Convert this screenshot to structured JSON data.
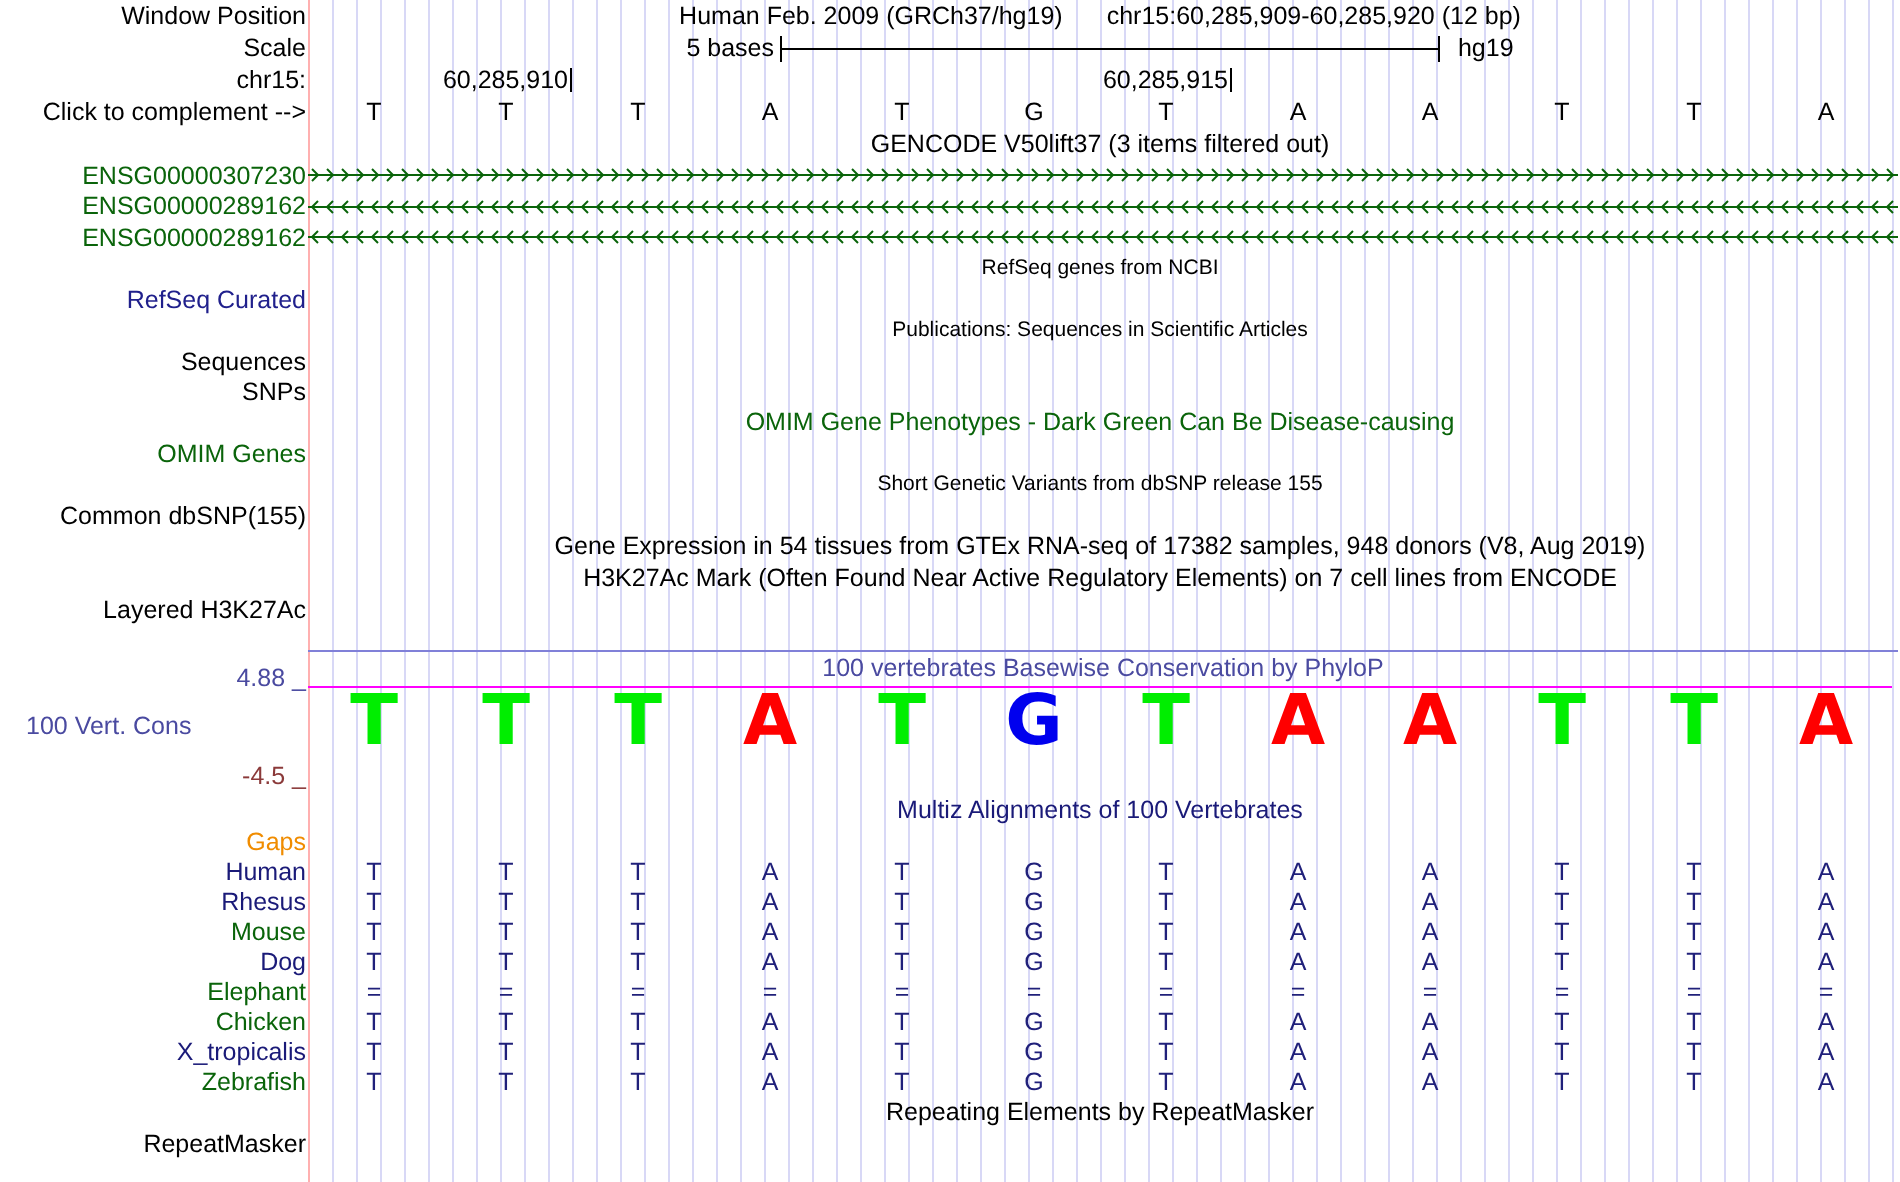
{
  "header": {
    "label": "Window Position",
    "assembly": "Human Feb. 2009 (GRCh37/hg19)",
    "position": "chr15:60,285,909-60,285,920 (12 bp)"
  },
  "scale": {
    "label": "Scale",
    "bar_label": "5 bases",
    "assembly": "hg19"
  },
  "coordinates": {
    "label": "chr15:",
    "ticks": [
      "60,285,910",
      "60,285,915"
    ]
  },
  "bases": {
    "label": "Click to complement -->",
    "sequence": [
      "T",
      "T",
      "T",
      "A",
      "T",
      "G",
      "T",
      "A",
      "A",
      "T",
      "T",
      "A"
    ]
  },
  "rows": [
    {
      "kind": "title",
      "text": "GENCODE V50lift37 (3 items filtered out)",
      "color": "#000000"
    },
    {
      "kind": "gene",
      "label": "ENSG00000307230",
      "color": "#0a640a",
      "reverse": false
    },
    {
      "kind": "gene",
      "label": "ENSG00000289162",
      "color": "#0a640a",
      "reverse": true
    },
    {
      "kind": "gene",
      "label": "ENSG00000289162",
      "color": "#0a640a",
      "reverse": true
    },
    {
      "kind": "small_title",
      "text": "RefSeq genes from NCBI",
      "color": "#000000"
    },
    {
      "kind": "label",
      "label": "RefSeq Curated",
      "color": "#20208c"
    },
    {
      "kind": "small_title",
      "text": "Publications: Sequences in Scientific Articles",
      "color": "#000000"
    },
    {
      "kind": "label",
      "label": "Sequences",
      "color": "#000000"
    },
    {
      "kind": "label",
      "label": "SNPs",
      "color": "#000000"
    },
    {
      "kind": "title",
      "text": "OMIM Gene Phenotypes - Dark Green Can Be Disease-causing",
      "color": "#0a640a"
    },
    {
      "kind": "label",
      "label": "OMIM Genes",
      "color": "#0a640a"
    },
    {
      "kind": "small_title",
      "text": "Short Genetic Variants from dbSNP release 155",
      "color": "#000000"
    },
    {
      "kind": "label",
      "label": "Common dbSNP(155)",
      "color": "#000000"
    },
    {
      "kind": "title",
      "text": "Gene Expression in 54 tissues from GTEx RNA-seq of 17382 samples, 948 donors (V8, Aug 2019)",
      "color": "#000000"
    },
    {
      "kind": "title",
      "text": "H3K27Ac Mark (Often Found Near Active Regulatory Elements) on 7 cell lines from ENCODE",
      "color": "#000000"
    },
    {
      "kind": "label",
      "label": "Layered H3K27Ac",
      "color": "#000000"
    },
    {
      "kind": "conservation",
      "title": "100 vertebrates Basewise Conservation by PhyloP",
      "label": "100 Vert. Cons",
      "max": "4.88 _",
      "min": "-4.5 _",
      "logo": [
        {
          "base": "T",
          "color": "#00ee00"
        },
        {
          "base": "T",
          "color": "#00ee00"
        },
        {
          "base": "T",
          "color": "#00ee00"
        },
        {
          "base": "A",
          "color": "#ff0000"
        },
        {
          "base": "T",
          "color": "#00ee00"
        },
        {
          "base": "G",
          "color": "#0000ee"
        },
        {
          "base": "T",
          "color": "#00ee00"
        },
        {
          "base": "A",
          "color": "#ff0000"
        },
        {
          "base": "A",
          "color": "#ff0000"
        },
        {
          "base": "T",
          "color": "#00ee00"
        },
        {
          "base": "T",
          "color": "#00ee00"
        },
        {
          "base": "A",
          "color": "#ff0000"
        }
      ]
    },
    {
      "kind": "title",
      "text": "Multiz Alignments of 100 Vertebrates",
      "color": "#1a1a78"
    },
    {
      "kind": "label",
      "label": "Gaps",
      "color": "#f08c00"
    },
    {
      "kind": "alignment",
      "label": "Human",
      "color": "#1a1a78",
      "bases": [
        "T",
        "T",
        "T",
        "A",
        "T",
        "G",
        "T",
        "A",
        "A",
        "T",
        "T",
        "A"
      ]
    },
    {
      "kind": "alignment",
      "label": "Rhesus",
      "color": "#1a1a78",
      "bases": [
        "T",
        "T",
        "T",
        "A",
        "T",
        "G",
        "T",
        "A",
        "A",
        "T",
        "T",
        "A"
      ]
    },
    {
      "kind": "alignment",
      "label": "Mouse",
      "color": "#0a640a",
      "bases": [
        "T",
        "T",
        "T",
        "A",
        "T",
        "G",
        "T",
        "A",
        "A",
        "T",
        "T",
        "A"
      ]
    },
    {
      "kind": "alignment",
      "label": "Dog",
      "color": "#1a1a78",
      "bases": [
        "T",
        "T",
        "T",
        "A",
        "T",
        "G",
        "T",
        "A",
        "A",
        "T",
        "T",
        "A"
      ]
    },
    {
      "kind": "alignment",
      "label": "Elephant",
      "color": "#0a640a",
      "bases": [
        "=",
        "=",
        "=",
        "=",
        "=",
        "=",
        "=",
        "=",
        "=",
        "=",
        "=",
        "="
      ]
    },
    {
      "kind": "alignment",
      "label": "Chicken",
      "color": "#0a640a",
      "bases": [
        "T",
        "T",
        "T",
        "A",
        "T",
        "G",
        "T",
        "A",
        "A",
        "T",
        "T",
        "A"
      ]
    },
    {
      "kind": "alignment",
      "label": "X_tropicalis",
      "color": "#1a1a78",
      "bases": [
        "T",
        "T",
        "T",
        "A",
        "T",
        "G",
        "T",
        "A",
        "A",
        "T",
        "T",
        "A"
      ]
    },
    {
      "kind": "alignment",
      "label": "Zebrafish",
      "color": "#0a640a",
      "bases": [
        "T",
        "T",
        "T",
        "A",
        "T",
        "G",
        "T",
        "A",
        "A",
        "T",
        "T",
        "A"
      ]
    },
    {
      "kind": "title",
      "text": "Repeating Elements by RepeatMasker",
      "color": "#000000"
    },
    {
      "kind": "label",
      "label": "RepeatMasker",
      "color": "#000000"
    }
  ]
}
